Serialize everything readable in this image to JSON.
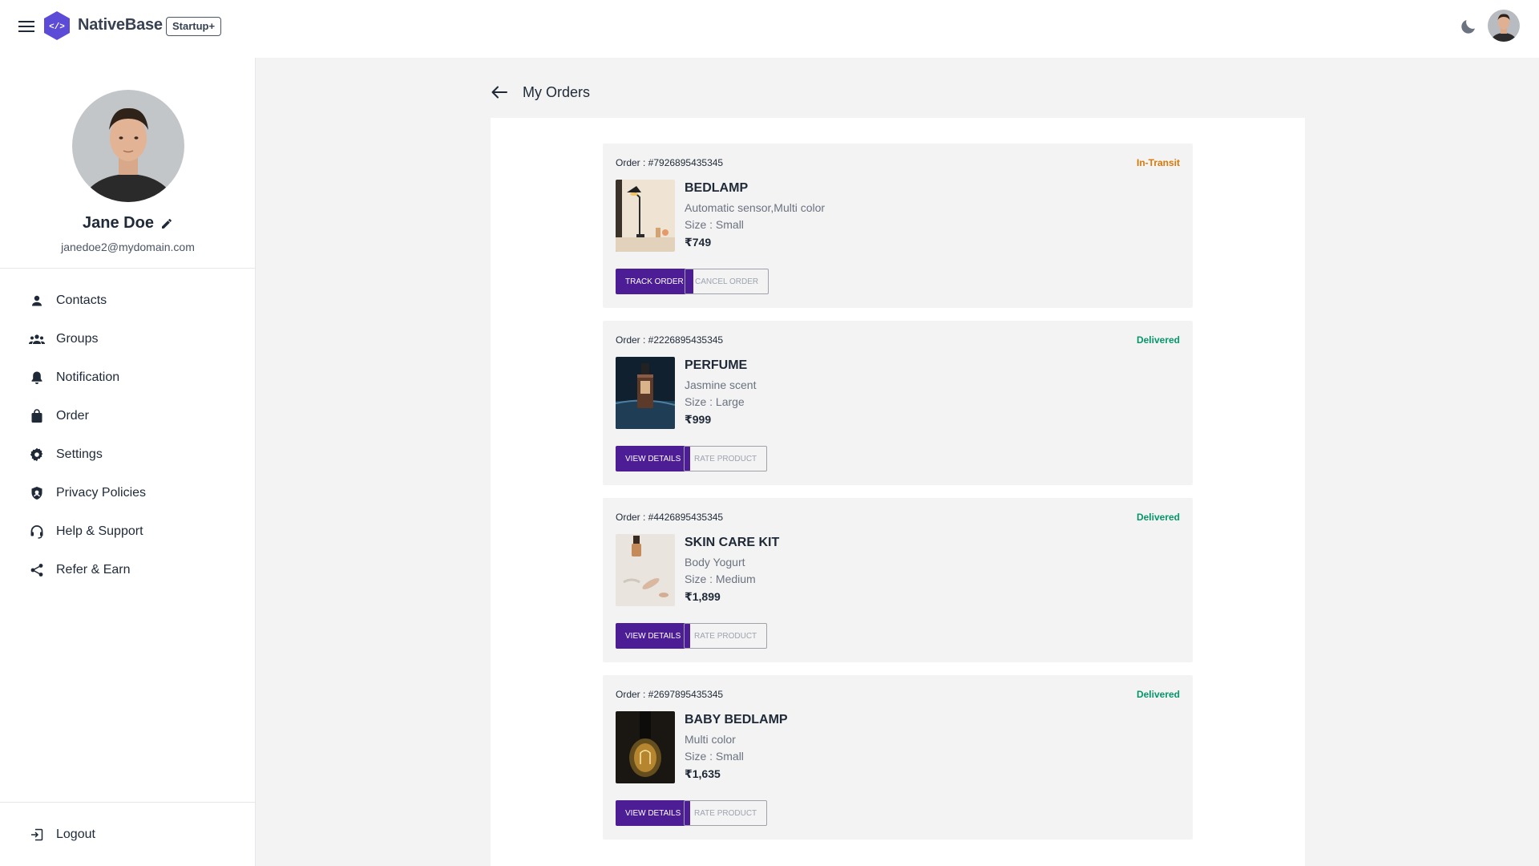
{
  "header": {
    "brand": "NativeBase",
    "plan_badge": "Startup+",
    "logo_glyph": "</>",
    "icons": [
      "hamburger-menu-icon",
      "nativebase-logo-icon",
      "moon-icon",
      "user-avatar"
    ]
  },
  "profile": {
    "name": "Jane Doe",
    "email": "janedoe2@mydomain.com"
  },
  "sidebar": {
    "items": [
      {
        "label": "Contacts",
        "icon": "person-icon"
      },
      {
        "label": "Groups",
        "icon": "groups-icon"
      },
      {
        "label": "Notification",
        "icon": "bell-icon"
      },
      {
        "label": "Order",
        "icon": "shopping-bag-icon"
      },
      {
        "label": "Settings",
        "icon": "gear-icon"
      },
      {
        "label": "Privacy Policies",
        "icon": "shield-icon"
      },
      {
        "label": "Help & Support",
        "icon": "headset-icon"
      },
      {
        "label": "Refer & Earn",
        "icon": "share-icon"
      }
    ],
    "logout_label": "Logout"
  },
  "page": {
    "title": "My Orders"
  },
  "colors": {
    "primary": "#4c1d95",
    "in_transit": "#d97706",
    "delivered": "#059669",
    "background": "#f3f3f3"
  },
  "orders": [
    {
      "id": "Order : #7926895435345",
      "status": "In-Transit",
      "name": "BEDLAMP",
      "desc": "Automatic sensor,Multi color",
      "size": "Size : Small",
      "price": "₹749",
      "primary_btn": "TRACK ORDER",
      "secondary_btn": "CANCEL ORDER"
    },
    {
      "id": "Order : #2226895435345",
      "status": "Delivered",
      "name": "PERFUME",
      "desc": "Jasmine scent",
      "size": "Size : Large",
      "price": "₹999",
      "primary_btn": "VIEW DETAILS",
      "secondary_btn": "RATE PRODUCT"
    },
    {
      "id": "Order : #4426895435345",
      "status": "Delivered",
      "name": "SKIN CARE KIT",
      "desc": "Body Yogurt",
      "size": "Size : Medium",
      "price": "₹1,899",
      "primary_btn": "VIEW DETAILS",
      "secondary_btn": "RATE PRODUCT"
    },
    {
      "id": "Order : #2697895435345",
      "status": "Delivered",
      "name": "BABY BEDLAMP",
      "desc": "Multi color",
      "size": "Size : Small",
      "price": "₹1,635",
      "primary_btn": "VIEW DETAILS",
      "secondary_btn": "RATE PRODUCT"
    }
  ]
}
